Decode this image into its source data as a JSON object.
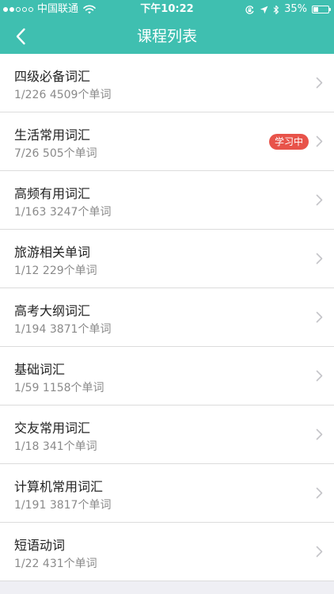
{
  "status_bar": {
    "carrier": "中国联通",
    "time": "下午10:22",
    "battery": "35%",
    "battery_level": 0.35,
    "signal_bars": 2,
    "signal_total": 5
  },
  "nav": {
    "title": "课程列表",
    "back_icon": "chevron-left-icon"
  },
  "colors": {
    "header": "#3fbfb0",
    "badge": "#e8534a",
    "title_text": "#222222",
    "sub_text": "#8a8a8a"
  },
  "courses": [
    {
      "name": "四级必备词汇",
      "progress": "1/226",
      "count": "4509个单词",
      "badge": ""
    },
    {
      "name": "生活常用词汇",
      "progress": "7/26",
      "count": "505个单词",
      "badge": "学习中"
    },
    {
      "name": "高频有用词汇",
      "progress": "1/163",
      "count": "3247个单词",
      "badge": ""
    },
    {
      "name": "旅游相关单词",
      "progress": "1/12",
      "count": "229个单词",
      "badge": ""
    },
    {
      "name": "高考大纲词汇",
      "progress": "1/194",
      "count": "3871个单词",
      "badge": ""
    },
    {
      "name": "基础词汇",
      "progress": "1/59",
      "count": "1158个单词",
      "badge": ""
    },
    {
      "name": "交友常用词汇",
      "progress": "1/18",
      "count": "341个单词",
      "badge": ""
    },
    {
      "name": "计算机常用词汇",
      "progress": "1/191",
      "count": "3817个单词",
      "badge": ""
    },
    {
      "name": "短语动词",
      "progress": "1/22",
      "count": "431个单词",
      "badge": ""
    }
  ]
}
